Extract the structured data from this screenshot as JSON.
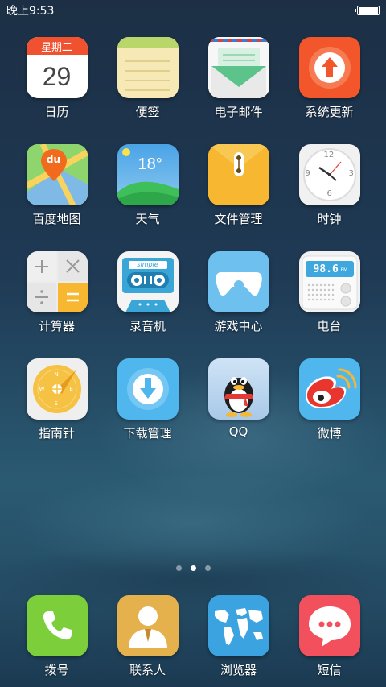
{
  "status_bar": {
    "time": "晚上9:53",
    "battery_level": 0.95
  },
  "apps": [
    {
      "label": "日历",
      "icon": "calendar-icon",
      "header_text": "星期二",
      "day": "29"
    },
    {
      "label": "便签",
      "icon": "notes-icon"
    },
    {
      "label": "电子邮件",
      "icon": "email-icon"
    },
    {
      "label": "系统更新",
      "icon": "update-icon"
    },
    {
      "label": "百度地图",
      "icon": "baidu-map-icon",
      "badge_text": "du"
    },
    {
      "label": "天气",
      "icon": "weather-icon",
      "temperature": "18°"
    },
    {
      "label": "文件管理",
      "icon": "file-manager-icon"
    },
    {
      "label": "时钟",
      "icon": "clock-icon",
      "numerals": {
        "n12": "12",
        "n3": "3",
        "n6": "6",
        "n9": "9"
      }
    },
    {
      "label": "计算器",
      "icon": "calculator-icon"
    },
    {
      "label": "录音机",
      "icon": "recorder-icon",
      "tape_label": "simple"
    },
    {
      "label": "游戏中心",
      "icon": "game-center-icon"
    },
    {
      "label": "电台",
      "icon": "radio-icon",
      "frequency": "98.6",
      "unit": "FM"
    },
    {
      "label": "指南针",
      "icon": "compass-icon",
      "directions": {
        "n": "N",
        "e": "E",
        "s": "S",
        "w": "W"
      }
    },
    {
      "label": "下载管理",
      "icon": "download-icon"
    },
    {
      "label": "QQ",
      "icon": "qq-icon"
    },
    {
      "label": "微博",
      "icon": "weibo-icon"
    }
  ],
  "page_indicator": {
    "count": 3,
    "active_index": 1
  },
  "dock": [
    {
      "label": "拨号",
      "icon": "phone-icon"
    },
    {
      "label": "联系人",
      "icon": "contacts-icon"
    },
    {
      "label": "浏览器",
      "icon": "browser-icon"
    },
    {
      "label": "短信",
      "icon": "sms-icon"
    }
  ],
  "colors": {
    "calendar_red": "#f0512e",
    "update_orange": "#f3562b",
    "weather_blue": "#5bb0e8",
    "file_yellow": "#f7b731",
    "game_blue": "#6ec1ef",
    "download_blue": "#4fb6ee",
    "phone_green": "#7cce3a",
    "contacts_gold": "#e4b14c",
    "browser_blue": "#3ba3e0",
    "sms_red": "#f2505d"
  }
}
